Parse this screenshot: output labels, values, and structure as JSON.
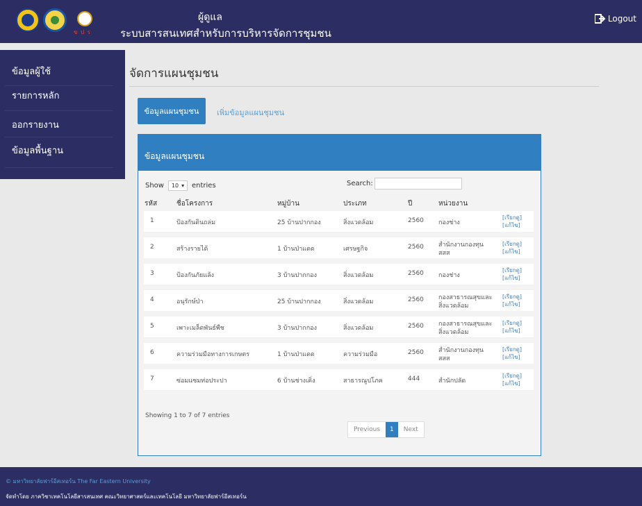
{
  "header": {
    "title_line1": "ผู้ดูแล",
    "title_line2": "ระบบสารสนเทศสำหรับการบริหารจัดการชุมชน",
    "logo3_text": "ข ป ร",
    "logout_label": "Logout"
  },
  "sidebar": {
    "items": [
      {
        "label": "ข้อมูลผู้ใช้"
      },
      {
        "label": "รายการหลัก"
      },
      {
        "label": "ออกรายงาน"
      },
      {
        "label": "ข้อมูลพื้นฐาน"
      }
    ]
  },
  "main": {
    "page_title": "จัดการแผนชุมชน",
    "tab_active": "ข้อมูลแผนชุมชน",
    "tab_link": "เพิ่มข้อมูลแผนชุมชน",
    "panel_title": "ข้อมูลแผนชุมชน",
    "show_label": "Show",
    "entries_value": "10",
    "entries_label": "entries",
    "search_label": "Search:",
    "search_value": "",
    "columns": [
      "รหัส",
      "ชื่อโครงการ",
      "หมู่บ้าน",
      "ประเภท",
      "ปี",
      "หน่วยงาน"
    ],
    "rows": [
      {
        "id": "1",
        "name": "ป้องกันดินถล่ม",
        "village": "25 บ้านปากกอง",
        "type": "สิ่งแวดล้อม",
        "year": "2560",
        "agency": "กองช่าง",
        "view": "[เรียกดู]",
        "edit": "[แก้ไข]"
      },
      {
        "id": "2",
        "name": "สร้างรายได้",
        "village": "1 บ้านป่าแดด",
        "type": "เศรษฐกิจ",
        "year": "2560",
        "agency": "สำนักงานกองทุน สสส",
        "view": "[เรียกดู]",
        "edit": "[แก้ไข]"
      },
      {
        "id": "3",
        "name": "ป้องกันภัยแล้ง",
        "village": "3 บ้านปากกอง",
        "type": "สิ่งแวดล้อม",
        "year": "2560",
        "agency": "กองช่าง",
        "view": "[เรียกดู]",
        "edit": "[แก้ไข]"
      },
      {
        "id": "4",
        "name": "อนุรักษ์ป่า",
        "village": "25 บ้านปากกอง",
        "type": "สิ่งแวดล้อม",
        "year": "2560",
        "agency": "กองสาธารณสุขและ สิ่งแวดล้อม",
        "view": "[เรียกดู]",
        "edit": "[แก้ไข]"
      },
      {
        "id": "5",
        "name": "เพาะเมล็ดพันธ์พืช",
        "village": "3 บ้านปากกอง",
        "type": "สิ่งแวดล้อม",
        "year": "2560",
        "agency": "กองสาธารณสุขและ สิ่งแวดล้อม",
        "view": "[เรียกดู]",
        "edit": "[แก้ไข]"
      },
      {
        "id": "6",
        "name": "ความร่วมมือทางการเกษตร",
        "village": "1 บ้านป่าแดด",
        "type": "ความร่วมมือ",
        "year": "2560",
        "agency": "สำนักงานกองทุน สสส",
        "view": "[เรียกดู]",
        "edit": "[แก้ไข]"
      },
      {
        "id": "7",
        "name": "ซ่อมแซมท่อประปา",
        "village": "6 บ้านช่างเคิ่ง",
        "type": "สาธารณูปโภค",
        "year": "444",
        "agency": "สำนักปลัด",
        "view": "[เรียกดู]",
        "edit": "[แก้ไข]"
      }
    ],
    "info": "Showing 1 to 7 of 7 entries",
    "pager": {
      "prev": "Previous",
      "current": "1",
      "next": "Next"
    }
  },
  "footer": {
    "line1": "© มหาวิทยาลัยฟาร์อีสเทอร์น The Far Eastern University",
    "line2": "จัดทำโดย ภาควิชาเทคโนโลยีสารสนเทศ คณะวิทยาศาสตร์และเทคโนโลยี มหาวิทยาลัยฟาร์อีสเทอร์น"
  },
  "colors": {
    "navy": "#2b2d63",
    "accent": "#2f7fc1",
    "link": "#3a7fc0"
  }
}
